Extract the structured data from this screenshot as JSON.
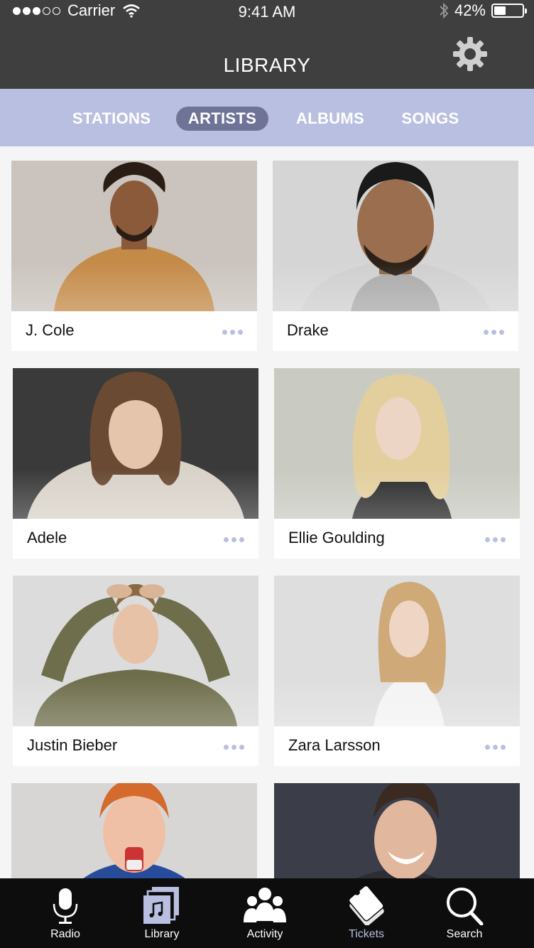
{
  "status_bar": {
    "carrier": "Carrier",
    "time": "9:41 AM",
    "battery": "42%",
    "battery_level": 0.42,
    "signal_bars_filled": 3,
    "signal_bars_total": 5
  },
  "header": {
    "title": "LIBRARY",
    "settings_icon": "gear-icon"
  },
  "tabs": [
    {
      "label": "STATIONS",
      "active": false
    },
    {
      "label": "ARTISTS",
      "active": true
    },
    {
      "label": "ALBUMS",
      "active": false
    },
    {
      "label": "SONGS",
      "active": false
    }
  ],
  "artists": [
    {
      "name": "J. Cole"
    },
    {
      "name": "Drake"
    },
    {
      "name": "Adele"
    },
    {
      "name": "Ellie Goulding"
    },
    {
      "name": "Justin Bieber"
    },
    {
      "name": "Zara Larsson"
    },
    {
      "name": ""
    },
    {
      "name": ""
    }
  ],
  "tab_bar": [
    {
      "label": "Radio",
      "icon": "microphone-icon"
    },
    {
      "label": "Library",
      "icon": "library-icon"
    },
    {
      "label": "Activity",
      "icon": "people-icon"
    },
    {
      "label": "Tickets",
      "icon": "tickets-icon"
    },
    {
      "label": "Search",
      "icon": "search-icon"
    }
  ],
  "colors": {
    "header_bg": "#3f3f3f",
    "accent": "#b9bfe0",
    "active_tab": "#6f7497",
    "tab_bar_bg": "#0d0d0d"
  }
}
